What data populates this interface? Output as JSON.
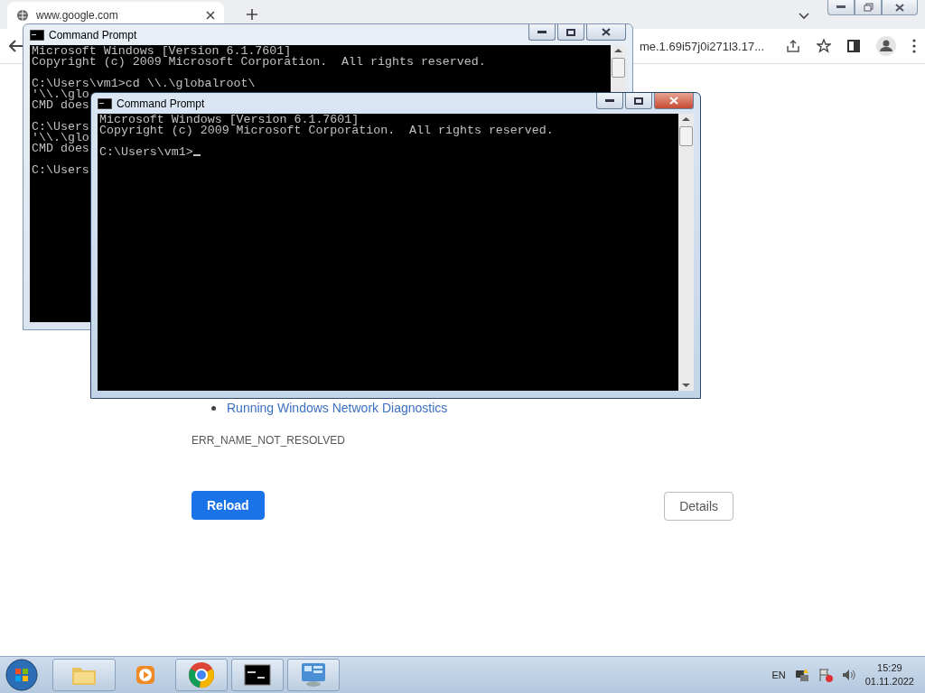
{
  "browser": {
    "tabs": [
      {
        "title": "www.google.com",
        "selected": true
      }
    ],
    "address": "me.1.69i57j0i271l3.17...",
    "page": {
      "links": [
        "Running Windows Network Diagnostics"
      ],
      "error_code": "ERR_NAME_NOT_RESOLVED",
      "buttons": [
        {
          "label": "Reload",
          "kind": "primary"
        },
        {
          "label": "Details",
          "kind": "secondary"
        }
      ]
    }
  },
  "windows": [
    {
      "title": "Command Prompt",
      "active": false,
      "cursor": false,
      "paragraphs": [
        [
          "Microsoft Windows [Version 6.1.7601]",
          "Copyright (c) 2009 Microsoft Corporation.  All rights reserved."
        ],
        [
          "C:\\Users\\vm1>cd \\\\.\\globalroot\\",
          "'\\\\.\\glo",
          "CMD does"
        ],
        [
          "C:\\Users",
          "'\\\\.\\glo",
          "CMD does"
        ],
        [
          "C:\\Users"
        ]
      ]
    },
    {
      "title": "Command Prompt",
      "active": true,
      "cursor": true,
      "paragraphs": [
        [
          "Microsoft Windows [Version 6.1.7601]",
          "Copyright (c) 2009 Microsoft Corporation.  All rights reserved."
        ],
        [
          "C:\\Users\\vm1>"
        ]
      ]
    }
  ],
  "taskbar": {
    "items": [
      {
        "kind": "folder",
        "open": true
      },
      {
        "kind": "media",
        "open": false
      },
      {
        "kind": "browser",
        "open": true
      },
      {
        "kind": "console",
        "open": true
      },
      {
        "kind": "panel",
        "open": true
      }
    ],
    "language": "EN",
    "time": "15:29",
    "date": "01.11.2022"
  }
}
